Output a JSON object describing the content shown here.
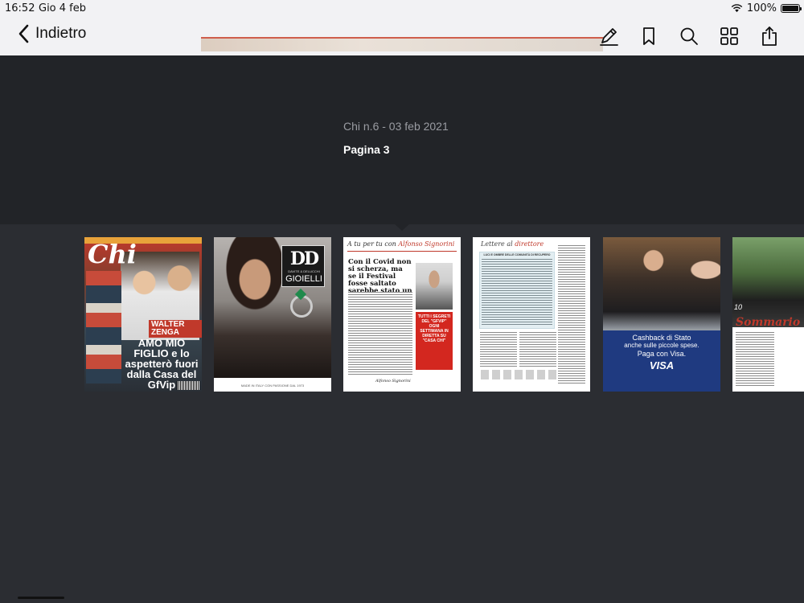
{
  "status_bar": {
    "time": "16:52",
    "date": "Gio 4 feb",
    "battery": "100%"
  },
  "nav": {
    "back_label": "Indietro",
    "tools": [
      "annotate-icon",
      "bookmark-icon",
      "search-icon",
      "grid-icon",
      "share-icon"
    ]
  },
  "issue": {
    "title": "Chi n.6 - 03 feb 2021",
    "page_label": "Pagina 3"
  },
  "thumbnails": {
    "cover": {
      "logo": "Chi",
      "name_tag": "WALTER ZENGA",
      "headline": "AMO MIO FIGLIO e lo aspetterò fuori dalla Casa del GfVip"
    },
    "ad_jewelry": {
      "logo": "DD",
      "brand_line": "DAVITE & DELUCCHI",
      "brand_word": "GIOIELLI",
      "footer": "MADE IN ITALY CON PASSIONE DAL 1973"
    },
    "editorial": {
      "kicker_prefix": "A tu per tu con",
      "kicker_name": "Alfonso Signorini",
      "title": "Con il Covid non si scherza, ma se il Festival fosse saltato sarebbe stato un colpo per tutti",
      "box_text": "TUTTI I SEGRETI DEL \"GFVIP\" OGNI SETTIMANA IN DIRETTA SU \"CASA CHI\"",
      "signature": "Alfonso Signorini"
    },
    "letters": {
      "heading_prefix": "Lettere al",
      "heading_word": "direttore",
      "box_title": "LUCI E OMBRE DELLE COMUNITÀ DI RECUPERO"
    },
    "ad_visa": {
      "line1": "Cashback di Stato",
      "line2": "anche sulle piccole spese.",
      "line3": "Paga con Visa.",
      "brand": "VISA"
    },
    "contents": {
      "number": "10",
      "title": "Sommario"
    }
  },
  "colors": {
    "topbar_bg": "#f2f2f4",
    "info_bg": "#222428",
    "strip_bg": "#2b2d32",
    "accent_red": "#c0392b",
    "visa_blue": "#1f3a80"
  }
}
